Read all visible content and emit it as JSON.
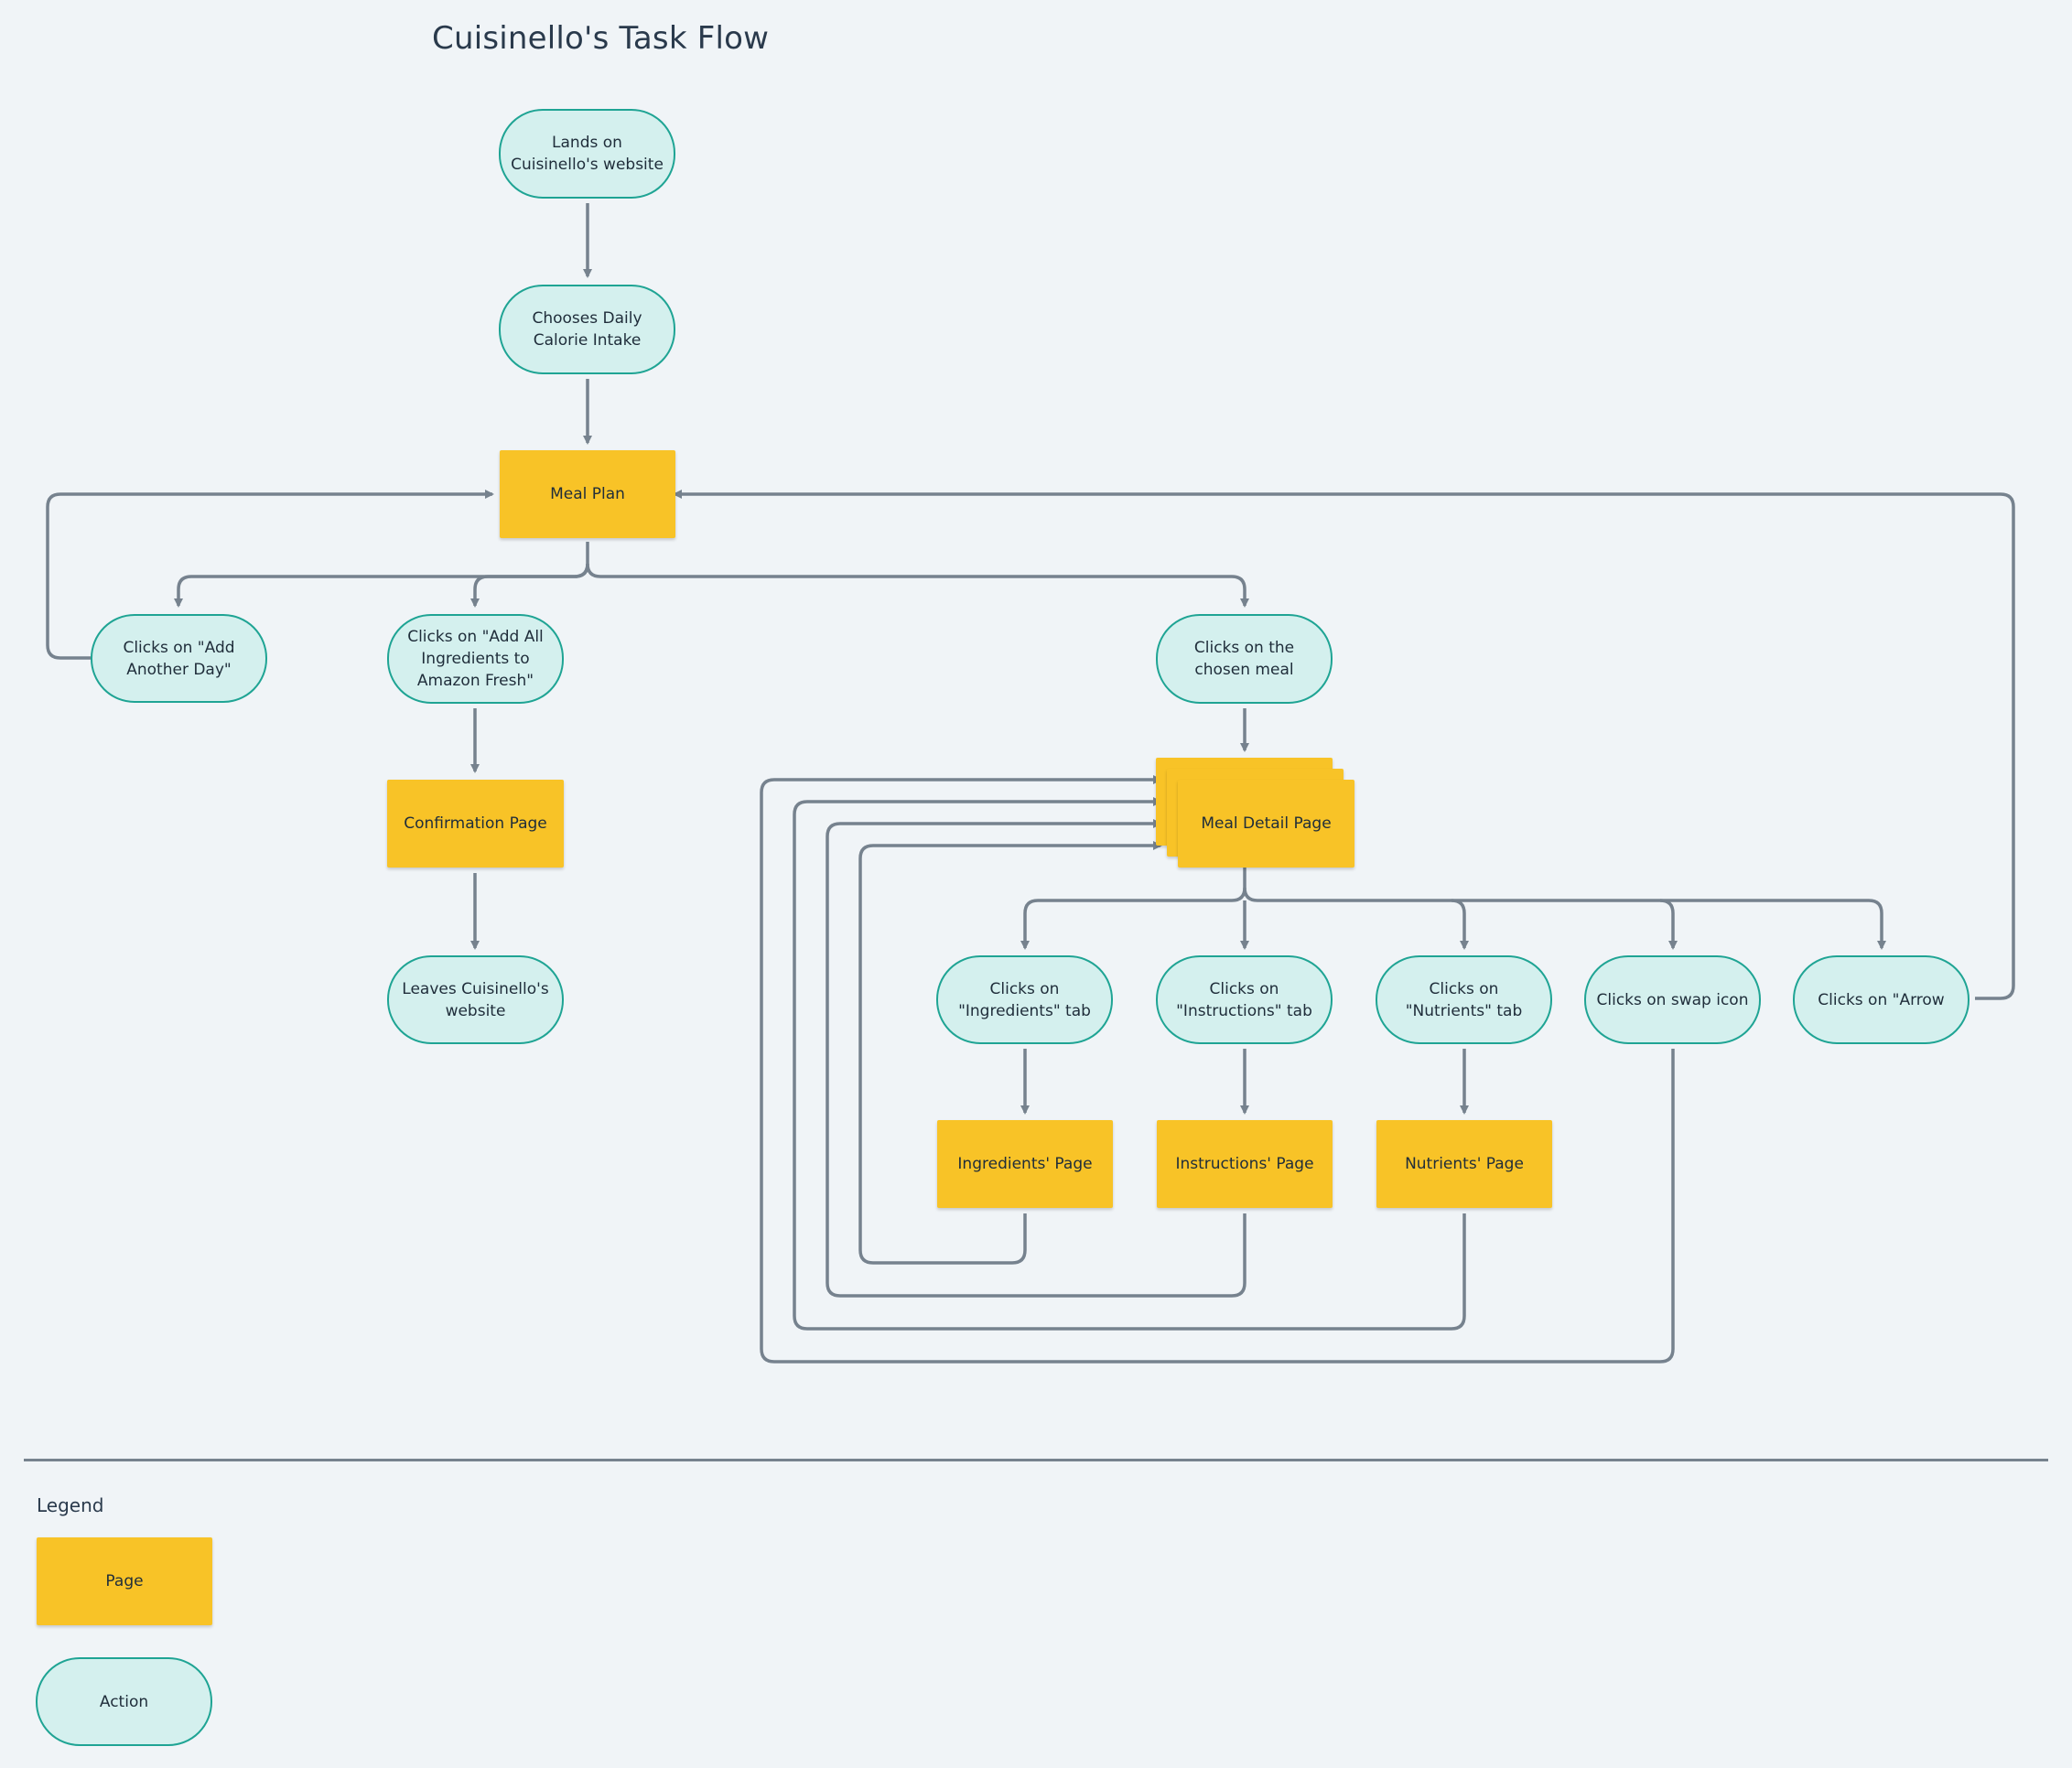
{
  "diagram": {
    "title": "Cuisinello's Task Flow",
    "nodes": {
      "lands": "Lands on Cuisinello's website",
      "chooses": "Chooses Daily Calorie Intake",
      "meal_plan": "Meal Plan",
      "add_day": "Clicks on \"Add Another Day\"",
      "add_ingredients": "Clicks on \"Add All Ingredients to Amazon Fresh\"",
      "chosen_meal": "Clicks on the chosen meal",
      "confirmation": "Confirmation Page",
      "leaves": "Leaves Cuisinello's website",
      "meal_detail": "Meal Detail Page",
      "ingredients_tab": "Clicks  on \"Ingredients\" tab",
      "instructions_tab": "Clicks on \"Instructions\" tab",
      "nutrients_tab": "Clicks on \"Nutrients\" tab",
      "swap": "Clicks on swap icon",
      "arrow": "Clicks on \"Arrow",
      "ingredients_page": "Ingredients' Page",
      "instructions_page": "Instructions' Page",
      "nutrients_page": "Nutrients' Page"
    },
    "edges": [
      {
        "from": "lands",
        "to": "chooses"
      },
      {
        "from": "chooses",
        "to": "meal_plan"
      },
      {
        "from": "meal_plan",
        "to": "add_day"
      },
      {
        "from": "meal_plan",
        "to": "add_ingredients"
      },
      {
        "from": "meal_plan",
        "to": "chosen_meal"
      },
      {
        "from": "add_day",
        "to": "meal_plan"
      },
      {
        "from": "add_ingredients",
        "to": "confirmation"
      },
      {
        "from": "confirmation",
        "to": "leaves"
      },
      {
        "from": "chosen_meal",
        "to": "meal_detail"
      },
      {
        "from": "meal_detail",
        "to": "ingredients_tab"
      },
      {
        "from": "meal_detail",
        "to": "instructions_tab"
      },
      {
        "from": "meal_detail",
        "to": "nutrients_tab"
      },
      {
        "from": "meal_detail",
        "to": "swap"
      },
      {
        "from": "meal_detail",
        "to": "arrow"
      },
      {
        "from": "ingredients_tab",
        "to": "ingredients_page"
      },
      {
        "from": "instructions_tab",
        "to": "instructions_page"
      },
      {
        "from": "nutrients_tab",
        "to": "nutrients_page"
      },
      {
        "from": "ingredients_page",
        "to": "meal_detail"
      },
      {
        "from": "instructions_page",
        "to": "meal_detail"
      },
      {
        "from": "nutrients_page",
        "to": "meal_detail"
      },
      {
        "from": "swap",
        "to": "meal_detail"
      },
      {
        "from": "arrow",
        "to": "meal_plan"
      }
    ]
  },
  "legend": {
    "title": "Legend",
    "page_label": "Page",
    "action_label": "Action"
  },
  "colors": {
    "background": "#f0f4f7",
    "page_fill": "#f8c327",
    "action_fill": "#d4f0ee",
    "action_border": "#1fa494",
    "connector": "#76828e"
  }
}
